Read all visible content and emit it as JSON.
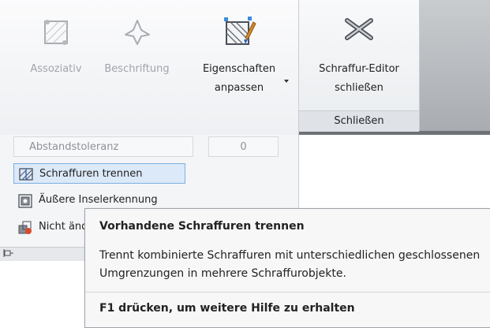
{
  "ribbon": {
    "buttons": {
      "assoziativ": "Assoziativ",
      "beschriftung": "Beschriftung",
      "eigenschaften_line1": "Eigenschaften",
      "eigenschaften_line2": "anpassen",
      "close_editor_line1": "Schraffur-Editor",
      "close_editor_line2": "schließen"
    },
    "panel_title": "Schließen"
  },
  "options_panel": {
    "tolerance_label": "Abstandstoleranz",
    "tolerance_value": "0",
    "items": [
      {
        "label": "Schraffuren trennen",
        "icon": "separate-hatches-icon"
      },
      {
        "label": "Äußere Inselerkennung",
        "icon": "island-detection-icon"
      },
      {
        "label": "Nicht ändern",
        "icon": "draw-order-icon"
      }
    ]
  },
  "tooltip": {
    "title": "Vorhandene Schraffuren trennen",
    "body": "Trennt kombinierte Schraffuren mit unterschiedlichen geschlossenen Umgrenzungen in mehrere Schraffurobjekte.",
    "help": "F1 drücken, um weitere Hilfe zu erhalten"
  }
}
